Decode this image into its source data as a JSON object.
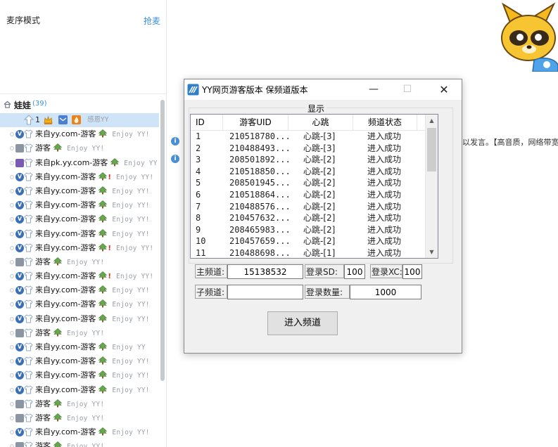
{
  "left_panel": {
    "mic_mode": "麦序模式",
    "grab_mic": "抢麦",
    "channel": {
      "name": "娃娃",
      "count": "(39)"
    },
    "selected_user": {
      "number": "1",
      "signature": "感恩YY"
    },
    "users": [
      {
        "badge": "V",
        "name": "来自yy.com-游客",
        "signature": "Enjoy YY!",
        "excl": false
      },
      {
        "badge": "G",
        "name": "游客",
        "signature": "Enjoy YY!",
        "excl": false
      },
      {
        "badge": "PK",
        "name": "来自pk.yy.com-游客",
        "signature": "Enjoy YY",
        "excl": false
      },
      {
        "badge": "V",
        "name": "来自yy.com-游客",
        "signature": "Enjoy YY!",
        "excl": true
      },
      {
        "badge": "V",
        "name": "来自yy.com-游客",
        "signature": "Enjoy YY!",
        "excl": false
      },
      {
        "badge": "V",
        "name": "来自yy.com-游客",
        "signature": "Enjoy YY!",
        "excl": false
      },
      {
        "badge": "V",
        "name": "来自yy.com-游客",
        "signature": "Enjoy YY!",
        "excl": false
      },
      {
        "badge": "V",
        "name": "来自yy.com-游客",
        "signature": "Enjoy YY!",
        "excl": false
      },
      {
        "badge": "V",
        "name": "来自yy.com-游客",
        "signature": "Enjoy YY!",
        "excl": true
      },
      {
        "badge": "G",
        "name": "游客",
        "signature": "Enjoy YY!",
        "excl": false
      },
      {
        "badge": "V",
        "name": "来自yy.com-游客",
        "signature": "Enjoy YY!",
        "excl": true
      },
      {
        "badge": "V",
        "name": "来自yy.com-游客",
        "signature": "Enjoy YY!",
        "excl": false
      },
      {
        "badge": "V",
        "name": "来自yy.com-游客",
        "signature": "Enjoy YY!",
        "excl": false
      },
      {
        "badge": "V",
        "name": "来自yy.com-游客",
        "signature": "Enjoy YY!",
        "excl": false
      },
      {
        "badge": "G",
        "name": "游客",
        "signature": "Enjoy YY!",
        "excl": false
      },
      {
        "badge": "V",
        "name": "来自yy.com-游客",
        "signature": "Enjoy YY",
        "excl": false
      },
      {
        "badge": "V",
        "name": "来自yy.com-游客",
        "signature": "Enjoy YY!",
        "excl": false
      },
      {
        "badge": "V",
        "name": "来自yy.com-游客",
        "signature": "Enjoy YY!",
        "excl": false
      },
      {
        "badge": "V",
        "name": "来自yy.com-游客",
        "signature": "Enjoy YY!",
        "excl": false
      },
      {
        "badge": "G",
        "name": "游客",
        "signature": "Enjoy YY!",
        "excl": false
      },
      {
        "badge": "G",
        "name": "游客",
        "signature": "Enjoy YY!",
        "excl": false
      },
      {
        "badge": "V",
        "name": "来自yy.com-游客",
        "signature": "Enjoy YY!",
        "excl": false
      },
      {
        "badge": "G",
        "name": "游客",
        "signature": "Enjoy YY!",
        "excl": false
      }
    ]
  },
  "right_area": {
    "info_text": "以发言。【高音质，网络带宽"
  },
  "dialog": {
    "title": "YY网页游客版本 保频道版本",
    "min_glyph": "—",
    "max_glyph": "☐",
    "close_glyph": "✕",
    "group_label": "显示",
    "columns": [
      "ID",
      "游客UID",
      "心跳",
      "频道状态"
    ],
    "rows": [
      {
        "id": "1",
        "uid": "210518780...",
        "heartbeat": "心跳-[3]",
        "status": "进入成功"
      },
      {
        "id": "2",
        "uid": "210488493...",
        "heartbeat": "心跳-[3]",
        "status": "进入成功"
      },
      {
        "id": "3",
        "uid": "208501892...",
        "heartbeat": "心跳-[2]",
        "status": "进入成功"
      },
      {
        "id": "4",
        "uid": "210518850...",
        "heartbeat": "心跳-[2]",
        "status": "进入成功"
      },
      {
        "id": "5",
        "uid": "208501945...",
        "heartbeat": "心跳-[2]",
        "status": "进入成功"
      },
      {
        "id": "6",
        "uid": "210518864...",
        "heartbeat": "心跳-[2]",
        "status": "进入成功"
      },
      {
        "id": "7",
        "uid": "210488576...",
        "heartbeat": "心跳-[2]",
        "status": "进入成功"
      },
      {
        "id": "8",
        "uid": "210457632...",
        "heartbeat": "心跳-[2]",
        "status": "进入成功"
      },
      {
        "id": "9",
        "uid": "208465983...",
        "heartbeat": "心跳-[2]",
        "status": "进入成功"
      },
      {
        "id": "10",
        "uid": "210457659...",
        "heartbeat": "心跳-[2]",
        "status": "进入成功"
      },
      {
        "id": "11",
        "uid": "210488698...",
        "heartbeat": "心跳-[1]",
        "status": "进入成功"
      }
    ],
    "main_channel_label": "主频道:",
    "main_channel_value": "15138532",
    "login_sd_label": "登录SD:",
    "login_sd_value": "100",
    "login_xc_label": "登录XC:",
    "login_xc_value": "100",
    "sub_channel_label": "子频道:",
    "sub_channel_value": "",
    "login_count_label": "登录数量:",
    "login_count_value": "1000",
    "enter_button": "进入频道"
  },
  "colors": {
    "accent_blue": "#3a8fdc",
    "selection": "#cfe4f7",
    "tree_green": "#6aa84f",
    "excl_red": "#e0261b"
  }
}
